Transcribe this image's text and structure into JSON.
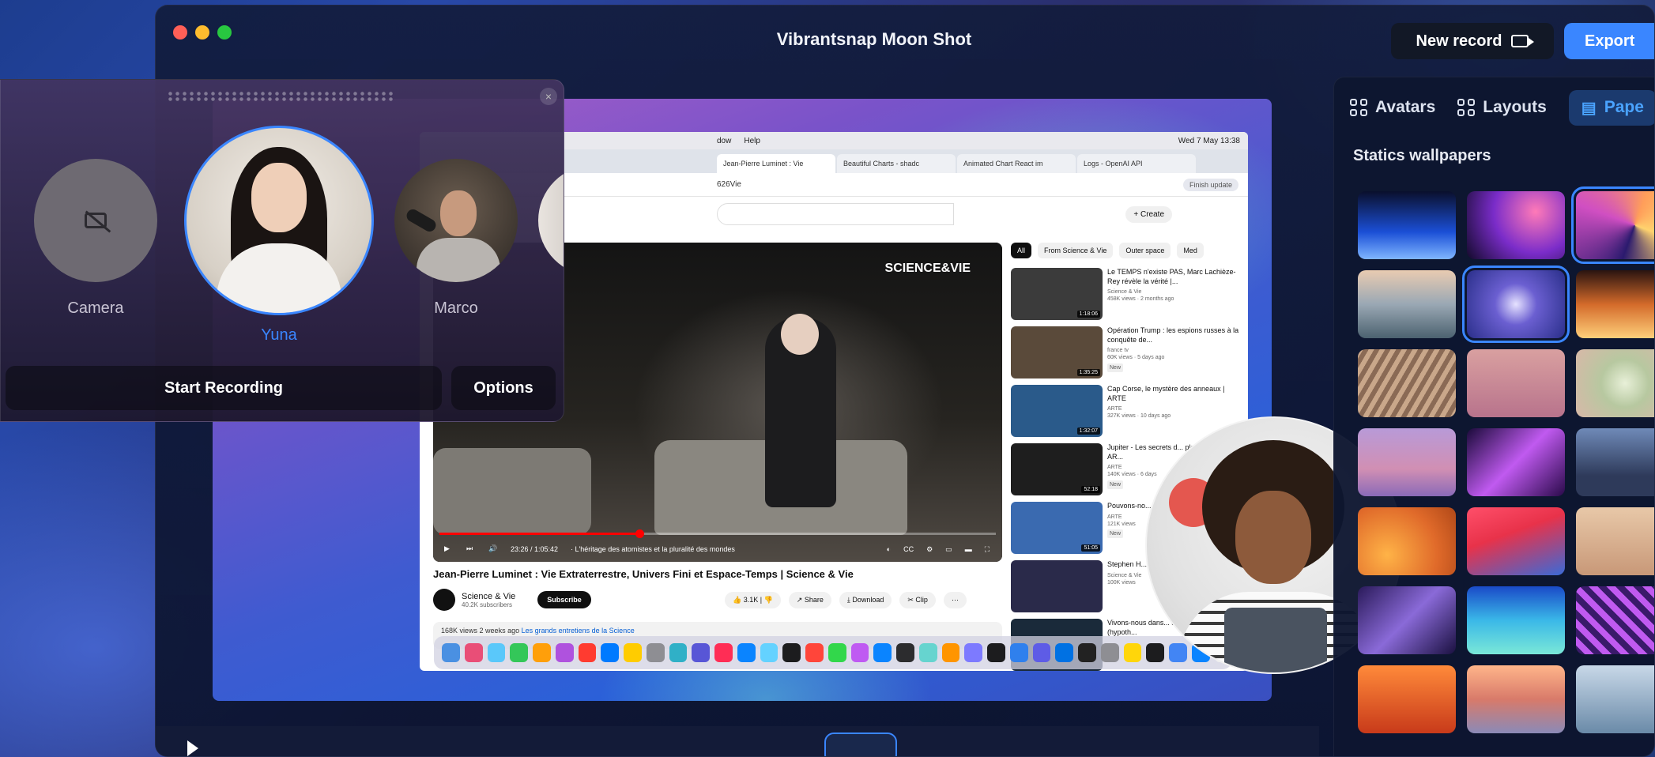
{
  "window": {
    "title": "Vibrantsnap Moon Shot",
    "new_record_label": "New record",
    "export_label": "Export"
  },
  "recorder": {
    "avatars": [
      {
        "label": "Camera",
        "state": "camera-off"
      },
      {
        "label": "Yuna",
        "state": "selected"
      },
      {
        "label": "Marco",
        "state": "default"
      }
    ],
    "start_label": "Start Recording",
    "options_label": "Options"
  },
  "side_panel": {
    "tabs": [
      {
        "label": "Avatars",
        "icon": "grid-icon"
      },
      {
        "label": "Layouts",
        "icon": "grid-icon"
      },
      {
        "label": "Pape",
        "icon": "layers-icon",
        "active": true
      }
    ],
    "heading": "Statics wallpapers",
    "selected_indices": [
      2,
      4
    ]
  },
  "capture": {
    "menubar": {
      "window_menu": "dow",
      "help_menu": "Help",
      "clock": "Wed 7 May 13:38"
    },
    "tabs": [
      {
        "label": "Jean-Pierre Luminet : Vie"
      },
      {
        "label": "Beautiful Charts - shadc"
      },
      {
        "label": "Animated Chart React im"
      },
      {
        "label": "Logs - OpenAI API"
      }
    ],
    "url_fragment": "626Vie",
    "finish_update": "Finish update",
    "create_label": "Create",
    "video": {
      "brand": "SCIENCE&VIE",
      "time": "23:26 / 1:05:42",
      "chapter": "· L'héritage des atomistes et la pluralité des mondes",
      "progress": 0.36,
      "title": "Jean-Pierre Luminet : Vie Extraterrestre, Univers Fini et Espace-Temps | Science & Vie",
      "channel": "Science & Vie",
      "subscribers": "40.2K subscribers",
      "subscribe_label": "Subscribe",
      "likes": "3.1K",
      "share_label": "Share",
      "download_label": "Download",
      "clip_label": "Clip",
      "views": "168K views",
      "age": "2 weeks ago",
      "playlist": "Les grands entretiens de la Science"
    },
    "chips": [
      "All",
      "From Science & Vie",
      "Outer space",
      "Med"
    ],
    "recs": [
      {
        "title": "Le TEMPS n'existe PAS, Marc Lachièze-Rey révèle la vérité |...",
        "channel": "Science & Vie",
        "meta": "458K views · 2 months ago",
        "duration": "1:18:06",
        "thumb": "#3b3b3b",
        "new": false
      },
      {
        "title": "Opération Trump : les espions russes à la conquête de...",
        "channel": "france tv",
        "meta": "60K views · 5 days ago",
        "duration": "1:35:25",
        "thumb": "#5a4a3a",
        "new": true
      },
      {
        "title": "Cap Corse, le mystère des anneaux | ARTE",
        "channel": "ARTE",
        "meta": "327K views · 10 days ago",
        "duration": "1:32:07",
        "thumb": "#2a5a8a",
        "new": false
      },
      {
        "title": "Jupiter - Les secrets d... planète géante | AR...",
        "channel": "ARTE",
        "meta": "140K views · 6 days",
        "duration": "52:18",
        "thumb": "#1e1e1e",
        "new": true
      },
      {
        "title": "Pouvons-no... planète ? |...",
        "channel": "ARTE",
        "meta": "121K views",
        "duration": "51:05",
        "thumb": "#3a6ab0",
        "new": true
      },
      {
        "title": "Stephen H... PARADOXE...",
        "channel": "Science & Vie",
        "meta": "100K views",
        "duration": "",
        "thumb": "#2a2a4a",
        "new": false
      },
      {
        "title": "Vivons-nous dans... simulation ? (hypoth...",
        "channel": "",
        "meta": "",
        "duration": "",
        "thumb": "#1a2a3a",
        "new": false
      }
    ]
  },
  "colors": {
    "accent": "#3a86ff",
    "export_bg": "#3a86ff",
    "new_record_bg": "#121826",
    "selected_avatar": "#3a86ff"
  }
}
